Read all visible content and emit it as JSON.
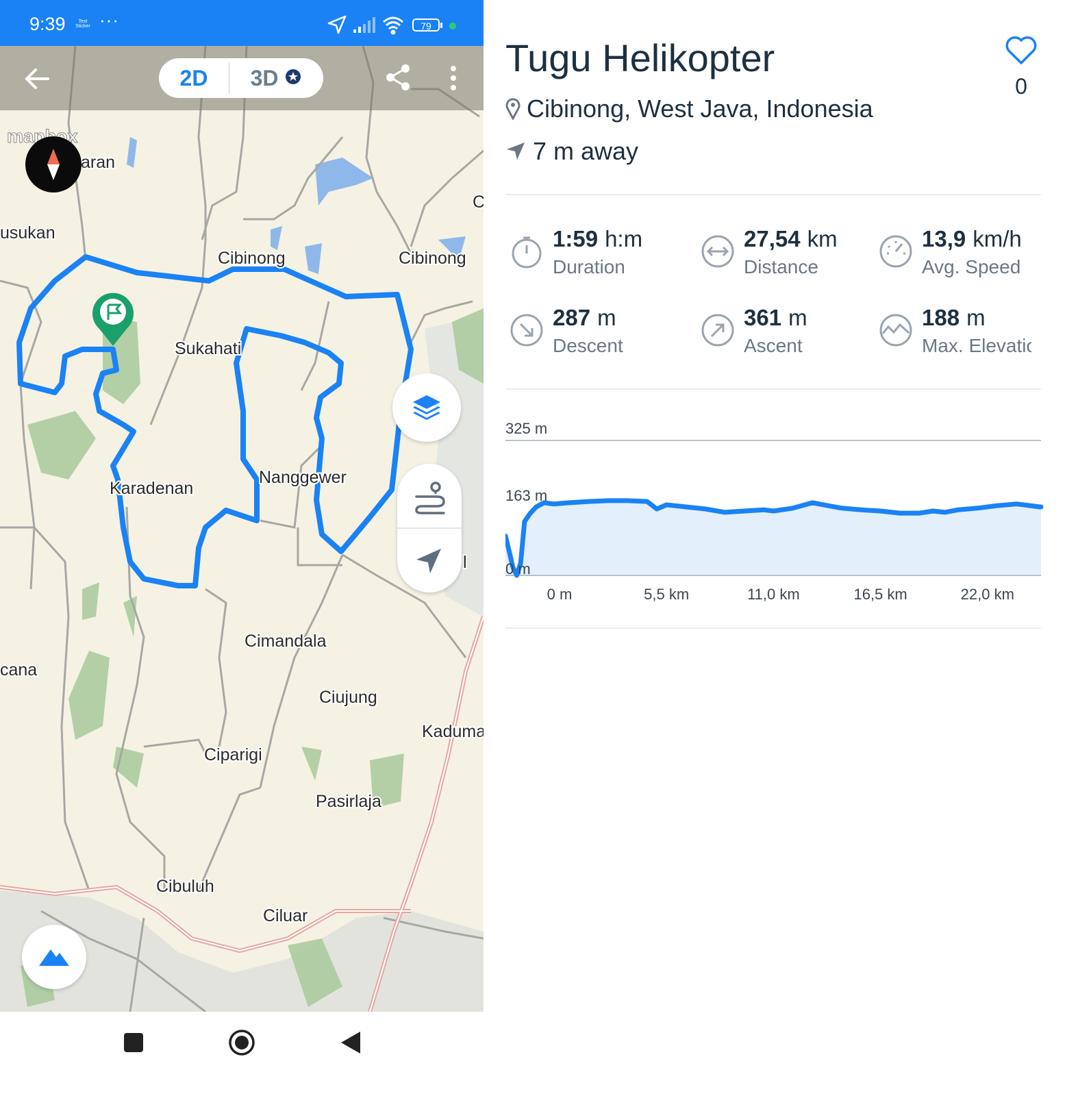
{
  "status_bar": {
    "time": "9:39",
    "sticker_text": "Text Sticker",
    "dots": "···",
    "battery": "79"
  },
  "map": {
    "view_2d": "2D",
    "view_3d": "3D",
    "attribution": "mapbox",
    "places": [
      "aran",
      "usukan",
      "Cibinong",
      "Cibinong",
      "C",
      "Sukahati",
      "Nanggewer",
      "Karadenan",
      "l",
      "Cimandala",
      "cana",
      "Ciujung",
      "Kaduma",
      "Ciparigi",
      "Pasirlaja",
      "Cibuluh",
      "Ciluar"
    ]
  },
  "detail": {
    "title": "Tugu Helikopter",
    "likes": "0",
    "location": "Cibinong, West Java, Indonesia",
    "distance_away": "7 m away"
  },
  "stats": [
    {
      "icon": "stopwatch-icon",
      "value": "1:59",
      "unit": "h:m",
      "label": "Duration"
    },
    {
      "icon": "distance-arrows-icon",
      "value": "27,54",
      "unit": "km",
      "label": "Distance"
    },
    {
      "icon": "speedometer-icon",
      "value": "13,9",
      "unit": "km/h",
      "label": "Avg. Speed"
    },
    {
      "icon": "descent-arrow-icon",
      "value": "287",
      "unit": "m",
      "label": "Descent"
    },
    {
      "icon": "ascent-arrow-icon",
      "value": "361",
      "unit": "m",
      "label": "Ascent"
    },
    {
      "icon": "elevation-peak-icon",
      "value": "188",
      "unit": "m",
      "label": "Max. Elevatio"
    }
  ],
  "chart_data": {
    "type": "area",
    "title": "",
    "xlabel": "",
    "ylabel": "",
    "xlim": [
      0,
      27.54
    ],
    "ylim": [
      0,
      325
    ],
    "x_ticks": [
      "0 m",
      "5,5 km",
      "11,0 km",
      "16,5 km",
      "22,0 km"
    ],
    "x_tick_values": [
      0,
      5.5,
      11.0,
      16.5,
      22.0
    ],
    "y_ticks": [
      "325 m",
      "163 m",
      "0 m"
    ],
    "y_tick_values": [
      325,
      163,
      0
    ],
    "grid": true,
    "color": "#1a82f5",
    "fill": "#e3effb",
    "x": [
      -2.8,
      -2.6,
      -2.4,
      -2.2,
      -2.0,
      -1.8,
      -1.5,
      -1.2,
      -0.8,
      -0.3,
      0.5,
      1.5,
      2.5,
      3.5,
      4.5,
      5.0,
      5.5,
      6.5,
      7.5,
      8.5,
      9.5,
      10.5,
      11.0,
      12.0,
      13.0,
      13.8,
      14.5,
      15.5,
      16.5,
      17.5,
      18.5,
      19.2,
      19.8,
      20.5,
      21.5,
      22.5,
      23.5,
      24.7
    ],
    "y": [
      95,
      60,
      20,
      0,
      30,
      130,
      150,
      165,
      175,
      172,
      175,
      178,
      180,
      180,
      178,
      160,
      170,
      165,
      160,
      152,
      155,
      158,
      155,
      162,
      175,
      168,
      162,
      158,
      155,
      150,
      150,
      155,
      152,
      158,
      162,
      168,
      172,
      165
    ]
  },
  "colors": {
    "accent": "#1a82f5",
    "route": "#1a82f5",
    "title": "#1e3040",
    "label": "#6b7785"
  }
}
